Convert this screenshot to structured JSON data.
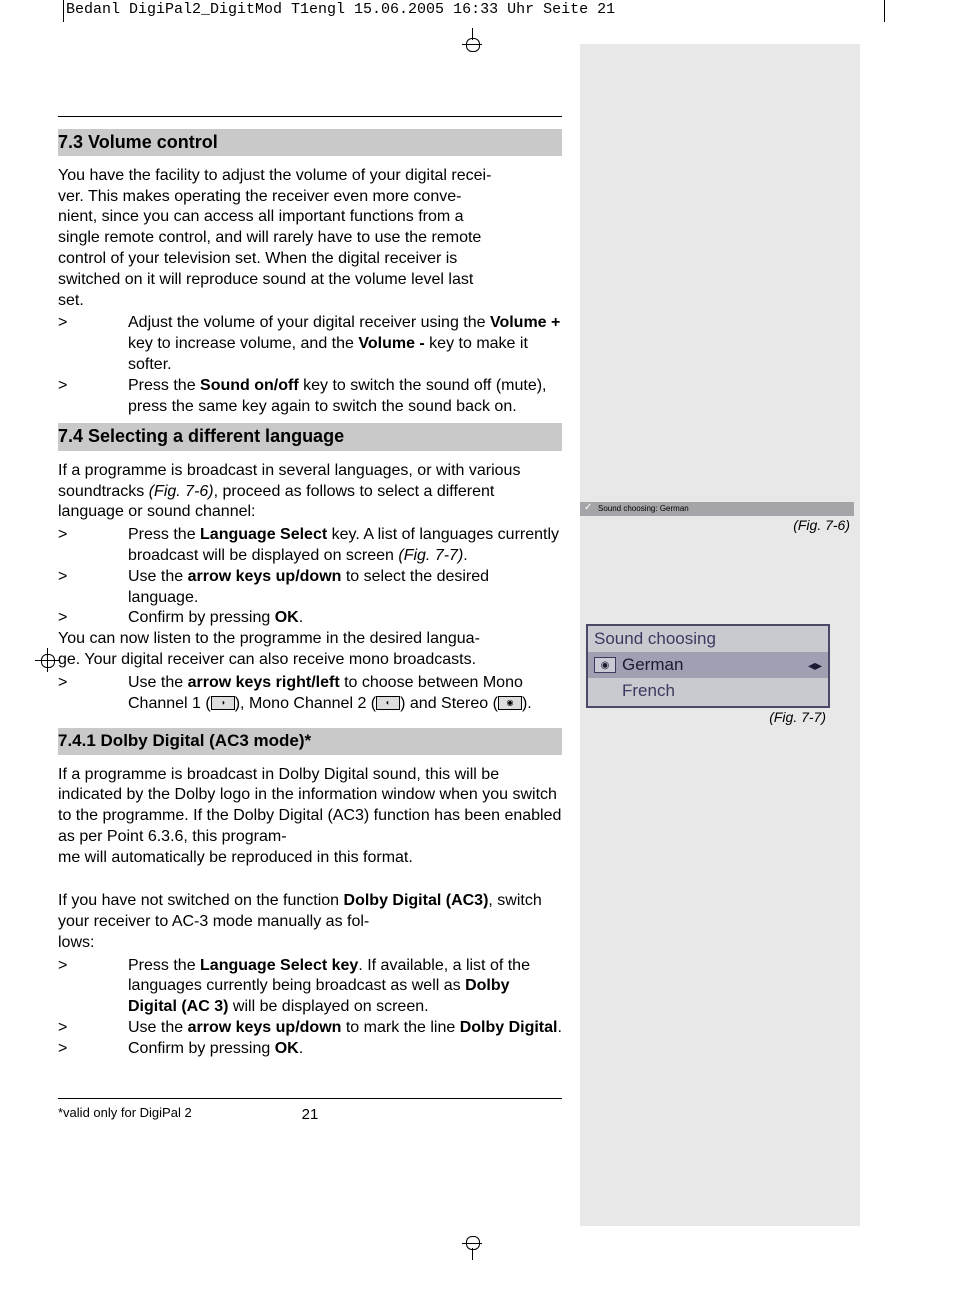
{
  "meta_header": "Bedanl DigiPal2_DigitMod T1engl  15.06.2005  16:33 Uhr  Seite 21",
  "page_number": "21",
  "footnote": "*valid only for DigiPal 2",
  "h73": "7.3 Volume control",
  "p73": "You have the facility to adjust the volume of your digital recei-\nver. This makes operating the receiver even more conve-\nnient, since you can access all important functions from a\nsingle remote control, and will rarely have to use the remote\ncontrol of your television set. When the digital receiver is\nswitched on it will reproduce sound at the volume level last\nset.",
  "s73a_pre": "Adjust the volume of your digital receiver using the ",
  "s73a_b1": "Volume +",
  "s73a_mid": " key to increase volume, and the ",
  "s73a_b2": "Volume -",
  "s73a_end": " key to make it softer.",
  "s73b_pre": "Press the ",
  "s73b_b": "Sound on/off",
  "s73b_end": " key to switch the sound off (mute), press the same key again to switch the sound back on.",
  "h74": "7.4 Selecting a different language",
  "p74_pre": "If a programme is broadcast in several languages, or with various soundtracks ",
  "p74_fig": "(Fig. 7-6)",
  "p74_end": ", proceed as follows to select a different language or sound channel:",
  "s74a_pre": "Press the ",
  "s74a_b": "Language Select",
  "s74a_mid": " key. A list of languages currently broadcast will be displayed on screen ",
  "s74a_fig": "(Fig. 7-7)",
  "s74a_dot": ".",
  "s74b_pre": "Use the ",
  "s74b_b": "arrow keys up/down",
  "s74b_end": " to select the desired language.",
  "s74c_pre": "Confirm by pressing ",
  "s74c_b": "OK",
  "s74c_end": ".",
  "p74b": "You can now listen to the programme in the desired langua-\nge. Your digital receiver can also receive mono broadcasts.",
  "s74d_pre": "Use the ",
  "s74d_b": "arrow keys right/left",
  "s74d_mid": " to choose between Mono Channel 1 (",
  "s74d_mid2": "), Mono Channel 2 (",
  "s74d_mid3": ") and Stereo (",
  "s74d_end": ").",
  "h741": "7.4.1 Dolby Digital (AC3 mode)*",
  "p741a": "If a programme is broadcast in Dolby Digital sound, this will be indicated by the Dolby logo in the information window when you switch to the programme. If the Dolby Digital (AC3) function has been enabled as per Point 6.3.6, this program-\nme will automatically be reproduced in this format.",
  "p741b_pre": "If you have not switched on the function ",
  "p741b_b": "Dolby Digital (AC3)",
  "p741b_end": ", switch your receiver to AC-3 mode manually as fol-\nlows:",
  "s741a_pre": "Press the ",
  "s741a_b": "Language Select key",
  "s741a_mid": ". If available, a list of the languages currently being broadcast as well as ",
  "s741a_b2": "Dolby Digital (AC 3)",
  "s741a_end": " will be displayed on screen.",
  "s741b_pre": "Use the ",
  "s741b_b": "arrow keys up/down",
  "s741b_mid": " to mark the line ",
  "s741b_b2": "Dolby Digital",
  "s741b_end": ".",
  "s741c_pre": "Confirm by pressing ",
  "s741c_b": "OK",
  "s741c_end": ".",
  "fig76_text": "Sound choosing: German",
  "fig76_caption": "(Fig. 7-6)",
  "fig77_title": "Sound choosing",
  "fig77_item1": "German",
  "fig77_item2": "French",
  "fig77_caption": "(Fig. 7-7)",
  "gt": ">"
}
